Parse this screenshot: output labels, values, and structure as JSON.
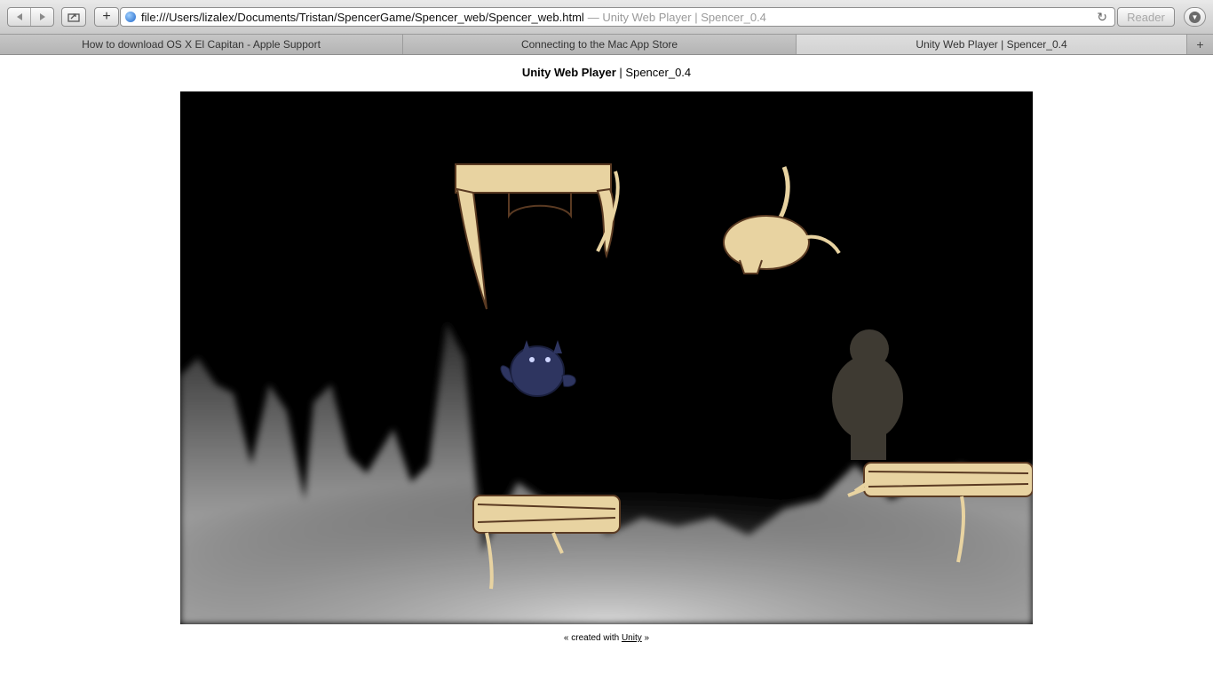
{
  "toolbar": {
    "url": "file:///Users/lizalex/Documents/Tristan/SpencerGame/Spencer_web/Spencer_web.html",
    "page_title_suffix": "— Unity Web Player | Spencer_0.4",
    "reader_label": "Reader"
  },
  "tabs": [
    {
      "label": "How to download OS X El Capitan - Apple Support"
    },
    {
      "label": "Connecting to the Mac App Store"
    },
    {
      "label": "Unity Web Player | Spencer_0.4"
    }
  ],
  "page": {
    "heading_bold": "Unity Web Player",
    "heading_sep": " | ",
    "heading_rest": "Spencer_0.4",
    "footer_prefix": "« created with ",
    "footer_link": "Unity",
    "footer_suffix": " »"
  },
  "colors": {
    "game_background": "#000000",
    "prop_fill": "#e8d3a1",
    "prop_stroke": "#5a3a22",
    "owl_fill": "#2e3560"
  }
}
